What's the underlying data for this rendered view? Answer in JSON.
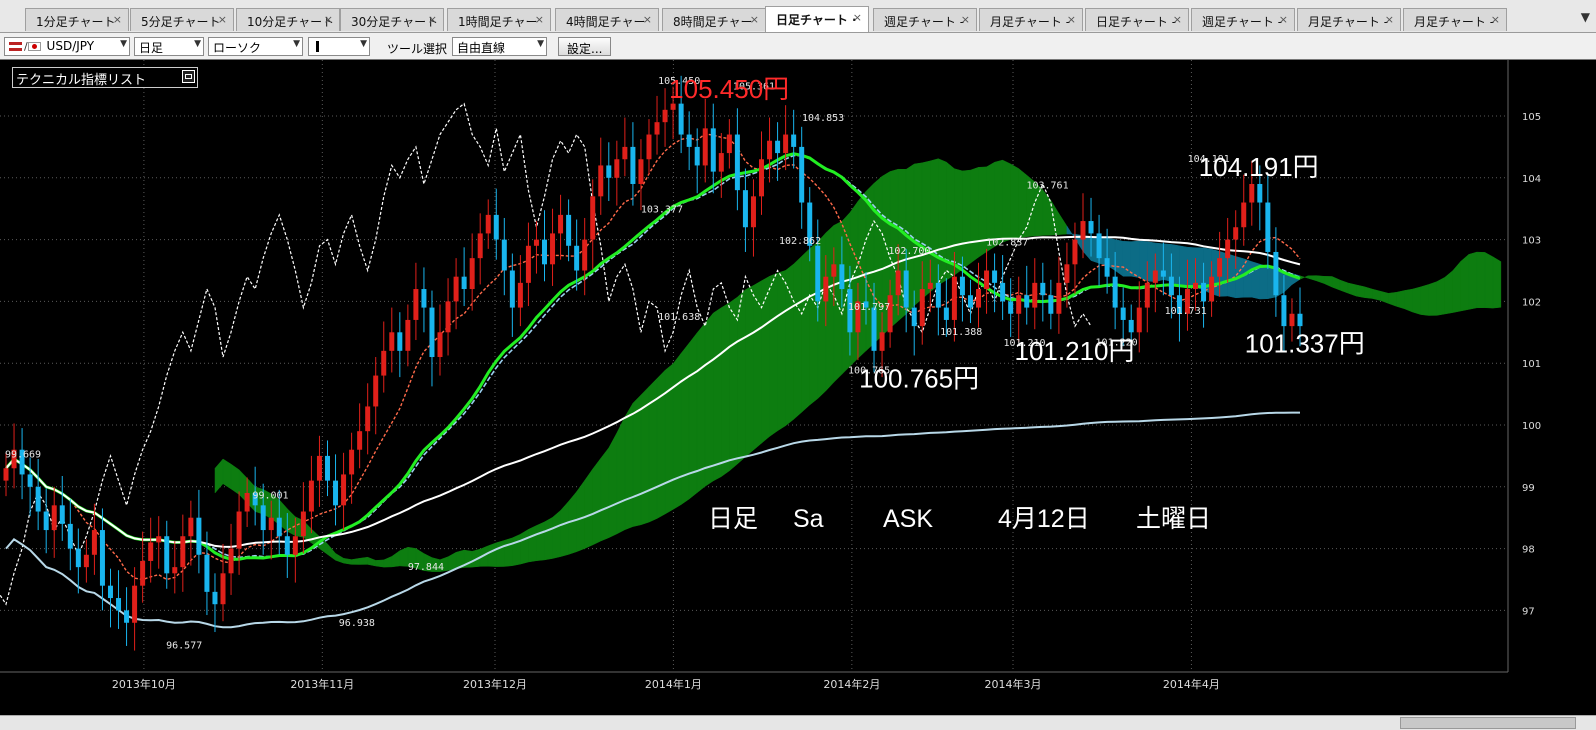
{
  "tabs": [
    {
      "label": "1分足チャート"
    },
    {
      "label": "5分足チャート"
    },
    {
      "label": "10分足チャート"
    },
    {
      "label": "30分足チャート"
    },
    {
      "label": "1時間足チャー"
    },
    {
      "label": "4時間足チャー"
    },
    {
      "label": "8時間足チャー"
    },
    {
      "label": "日足チャート ·"
    },
    {
      "label": "週足チャート -"
    },
    {
      "label": "月足チャート -"
    },
    {
      "label": "日足チャート -"
    },
    {
      "label": "週足チャート -"
    },
    {
      "label": "月足チャート -"
    },
    {
      "label": "月足チャート -"
    }
  ],
  "active_tab": 7,
  "tab_close_glyph": "×",
  "tab_menu_glyph": "▼",
  "toolbar": {
    "pair": "USD/JPY",
    "period": "日足",
    "candle_type": "ローソク",
    "tool_label": "ツール選択",
    "tool_value": "自由直線",
    "settings_label": "設定..."
  },
  "indicator_panel": {
    "title": "テクニカル指標リスト"
  },
  "colors": {
    "background": "#000000",
    "bull_candle": "#e0201a",
    "bear_candle": "#19b5ee",
    "kumo_bullish": "#0d7d10",
    "kumo_bearish": "#0c6c86",
    "tenkan": "#ff6a4a",
    "kijun": "#9ad0f0",
    "chikou": "#ffffff",
    "ma_green": "#22ee22",
    "ma_white": "#ffffff",
    "ma_light_blue": "#b8d8e8",
    "annotation_red": "#ff2a2a"
  },
  "chart_data": {
    "type": "candlestick",
    "instrument": "USD/JPY",
    "timeframe": "日足",
    "ylim": [
      96.6,
      105.8
    ],
    "y_ticks": [
      "105",
      "104",
      "103",
      "102",
      "101",
      "100",
      "99",
      "98",
      "97"
    ],
    "x_labels": [
      {
        "label": "2013年10月",
        "date": "2013-10-01"
      },
      {
        "label": "2013年11月",
        "date": "2013-11-01"
      },
      {
        "label": "2013年12月",
        "date": "2013-12-01"
      },
      {
        "label": "2014年1月",
        "date": "2014-01-01"
      },
      {
        "label": "2014年2月",
        "date": "2014-02-01"
      },
      {
        "label": "2014年3月",
        "date": "2014-03-01"
      },
      {
        "label": "2014年4月",
        "date": "2014-04-01"
      }
    ],
    "x_range": [
      "2013-09-06",
      "2014-05-26"
    ],
    "candle_closes": [
      99.3,
      99.6,
      99.2,
      99.0,
      98.6,
      98.3,
      98.7,
      98.4,
      98.0,
      97.7,
      97.9,
      98.3,
      97.4,
      97.2,
      97.0,
      96.8,
      97.4,
      97.8,
      98.1,
      98.2,
      97.6,
      97.7,
      98.2,
      98.5,
      97.9,
      97.3,
      97.1,
      97.6,
      98.0,
      98.6,
      98.9,
      98.7,
      98.3,
      98.5,
      98.2,
      97.9,
      98.2,
      98.6,
      99.1,
      99.5,
      99.1,
      98.7,
      99.2,
      99.6,
      99.9,
      100.3,
      100.8,
      101.2,
      101.5,
      101.2,
      101.7,
      102.2,
      101.9,
      101.1,
      101.5,
      102.0,
      102.4,
      102.2,
      102.7,
      103.1,
      103.4,
      103.0,
      102.5,
      101.9,
      102.3,
      102.9,
      103.0,
      102.6,
      103.1,
      103.4,
      102.9,
      102.5,
      103.0,
      103.7,
      104.2,
      104.0,
      104.3,
      104.5,
      103.9,
      104.3,
      104.7,
      104.9,
      105.1,
      105.2,
      104.7,
      104.5,
      104.2,
      104.8,
      104.1,
      104.4,
      104.7,
      103.8,
      103.2,
      103.7,
      104.3,
      104.6,
      104.4,
      104.7,
      104.5,
      103.6,
      102.9,
      102.0,
      102.4,
      102.6,
      102.2,
      101.5,
      102.0,
      101.9,
      101.2,
      101.5,
      102.1,
      102.5,
      101.9,
      101.6,
      102.2,
      102.3,
      101.9,
      101.7,
      102.4,
      102.1,
      101.9,
      102.2,
      102.5,
      102.3,
      102.0,
      101.8,
      102.1,
      101.9,
      102.3,
      102.1,
      101.8,
      102.3,
      102.6,
      103.0,
      103.3,
      103.1,
      102.7,
      102.4,
      101.9,
      101.7,
      101.5,
      101.9,
      102.3,
      102.5,
      102.4,
      102.1,
      101.8,
      102.2,
      102.3,
      102.0,
      102.4,
      102.7,
      103.0,
      103.2,
      103.6,
      103.9,
      103.6,
      102.8,
      102.1,
      101.6,
      101.8,
      101.6
    ],
    "labeled_points": [
      {
        "label": "99.669",
        "date": "2013-09-10",
        "value": 99.669
      },
      {
        "label": "96.577",
        "date": "2013-10-08",
        "value": 96.577
      },
      {
        "label": "99.001",
        "date": "2013-10-23",
        "value": 99.001
      },
      {
        "label": "96.938",
        "date": "2013-11-07",
        "value": 96.938
      },
      {
        "label": "97.844",
        "date": "2013-11-19",
        "value": 97.844
      },
      {
        "label": "103.377",
        "date": "2013-12-30",
        "value": 103.377
      },
      {
        "label": "101.638",
        "date": "2014-01-02",
        "value": 101.638
      },
      {
        "label": "105.450",
        "date": "2014-01-02",
        "value": 105.45
      },
      {
        "label": "105.361",
        "date": "2014-01-15",
        "value": 105.361
      },
      {
        "label": "102.862",
        "date": "2014-01-23",
        "value": 102.862
      },
      {
        "label": "104.853",
        "date": "2014-01-27",
        "value": 104.853
      },
      {
        "label": "101.797",
        "date": "2014-02-04",
        "value": 101.797
      },
      {
        "label": "100.765",
        "date": "2014-02-04",
        "value": 100.765
      },
      {
        "label": "102.700",
        "date": "2014-02-11",
        "value": 102.7
      },
      {
        "label": "101.388",
        "date": "2014-02-20",
        "value": 101.388
      },
      {
        "label": "102.837",
        "date": "2014-02-28",
        "value": 102.837
      },
      {
        "label": "103.761",
        "date": "2014-03-07",
        "value": 103.761
      },
      {
        "label": "101.210",
        "date": "2014-03-03",
        "value": 101.21
      },
      {
        "label": "101.220",
        "date": "2014-03-19",
        "value": 101.22
      },
      {
        "label": "101.731",
        "date": "2014-03-31",
        "value": 101.731
      },
      {
        "label": "104.191",
        "date": "2014-04-04",
        "value": 104.191
      }
    ],
    "annotations": [
      {
        "label": "105.450円",
        "date": "2014-01-02",
        "value": 105.45,
        "color": "#ff2a2a"
      },
      {
        "label": "104.191円",
        "date": "2014-04-04",
        "value": 104.191,
        "color": "#ffffff"
      },
      {
        "label": "101.210円",
        "date": "2014-03-03",
        "value": 101.21,
        "color": "#ffffff"
      },
      {
        "label": "101.337円",
        "date": "2014-04-12",
        "value": 101.337,
        "color": "#ffffff"
      },
      {
        "label": "100.765円",
        "date": "2014-02-04",
        "value": 100.765,
        "color": "#ffffff"
      }
    ],
    "info_text": [
      "日足",
      "Sa",
      "ASK",
      "4月12日",
      "土曜日"
    ],
    "grid": true
  }
}
